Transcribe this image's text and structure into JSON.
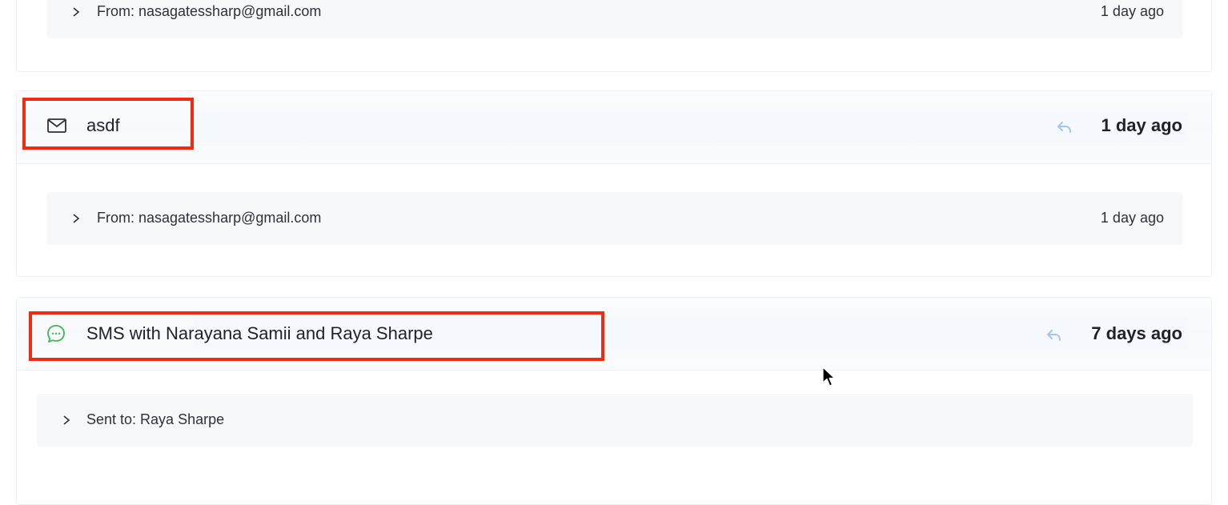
{
  "activities": [
    {
      "detail": {
        "label": "From: nasagatessharp@gmail.com",
        "time": "1 day ago"
      }
    },
    {
      "kind": "email",
      "icon": "envelope-icon",
      "title": "asdf",
      "time": "1 day ago",
      "detail": {
        "label": "From: nasagatessharp@gmail.com",
        "time": "1 day ago"
      }
    },
    {
      "kind": "sms",
      "icon": "chat-bubble-icon",
      "title": "SMS with Narayana Samii and Raya Sharpe",
      "time": "7 days ago",
      "detail": {
        "label": "Sent to: Raya Sharpe"
      }
    }
  ],
  "colors": {
    "highlight": "#ef2b12",
    "sms_icon": "#3fb950",
    "reply_icon": "#a9c4e6"
  }
}
